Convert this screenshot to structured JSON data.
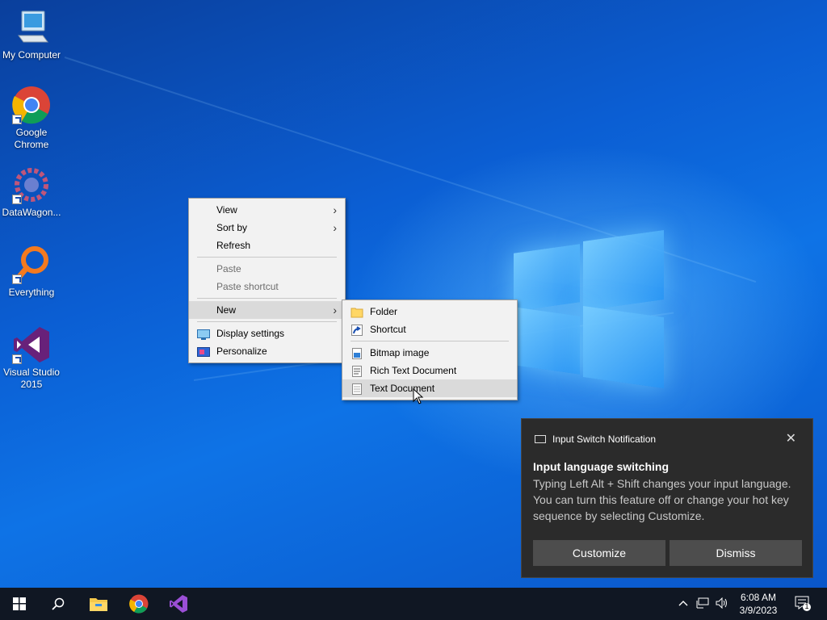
{
  "desktop_icons": [
    {
      "label": "My Computer"
    },
    {
      "label": "Google Chrome"
    },
    {
      "label": "DataWagon..."
    },
    {
      "label": "Everything"
    },
    {
      "label": "Visual Studio 2015"
    }
  ],
  "context_menu": {
    "items": [
      {
        "label": "View",
        "submenu": true
      },
      {
        "label": "Sort by",
        "submenu": true
      },
      {
        "label": "Refresh"
      },
      {
        "label": "Paste",
        "disabled": true
      },
      {
        "label": "Paste shortcut",
        "disabled": true
      },
      {
        "label": "New",
        "submenu": true,
        "highlighted": true
      },
      {
        "label": "Display settings",
        "icon": "display-icon"
      },
      {
        "label": "Personalize",
        "icon": "personalize-icon"
      }
    ],
    "arrow_glyph": "›"
  },
  "new_submenu": {
    "items": [
      {
        "label": "Folder",
        "icon": "folder-icon"
      },
      {
        "label": "Shortcut",
        "icon": "shortcut-icon"
      },
      {
        "label": "Bitmap image",
        "icon": "bitmap-icon"
      },
      {
        "label": "Rich Text Document",
        "icon": "rtf-icon"
      },
      {
        "label": "Text Document",
        "icon": "text-document-icon",
        "highlighted": true
      }
    ]
  },
  "notification": {
    "app_name": "Input Switch Notification",
    "close_glyph": "✕",
    "title": "Input language switching",
    "body": "Typing Left Alt + Shift changes your input language. You can turn this feature off or change your hot key sequence by selecting Customize.",
    "buttons": {
      "customize": "Customize",
      "dismiss": "Dismiss"
    }
  },
  "taskbar": {
    "pinned": [
      "start-icon",
      "search-icon",
      "file-explorer-icon",
      "chrome-icon",
      "visual-studio-icon"
    ],
    "tray": {
      "chevron": "^",
      "volume_glyph": "🔊"
    },
    "clock": {
      "time": "6:08 AM",
      "date": "3/9/2023"
    },
    "notification_count": "1"
  },
  "colors": {
    "menu_bg": "#f2f2f2",
    "toast_bg": "#2b2b2b",
    "taskbar_bg": "#101723",
    "desktop_blue": "#0b5ed3"
  }
}
